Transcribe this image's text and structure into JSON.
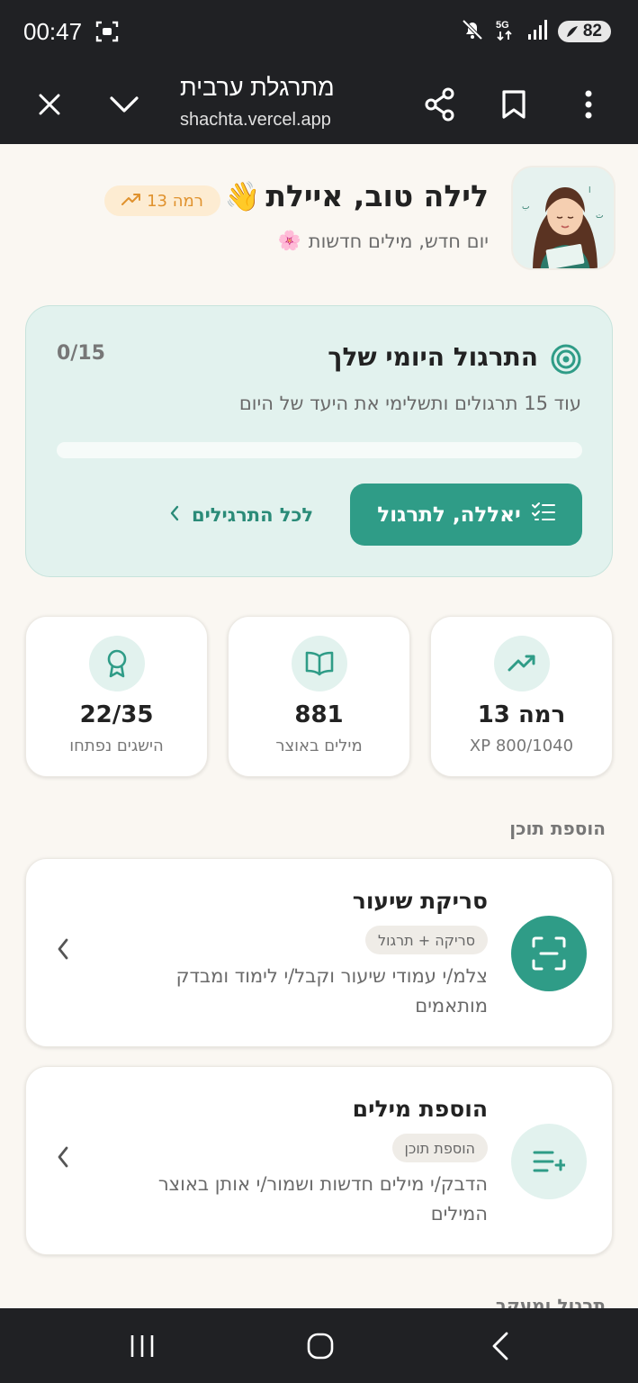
{
  "status_bar": {
    "time": "00:47",
    "battery": "82",
    "icons": [
      "screen-record-icon",
      "mute-icon",
      "5g-icon",
      "signal-icon",
      "battery-icon"
    ]
  },
  "browser": {
    "title": "מתרגלת ערבית",
    "url": "shachta.vercel.app"
  },
  "header": {
    "greeting": "לילה טוב, איילת",
    "greeting_emoji": "👋",
    "level_badge": "רמה 13",
    "subtitle": "יום חדש, מילים חדשות",
    "subtitle_emoji": "🌸"
  },
  "daily": {
    "title": "התרגול היומי שלך",
    "count": "0/15",
    "subtitle": "עוד 15 תרגולים ותשלימי את היעד של היום",
    "progress": 0,
    "start_button": "יאללה, לתרגול",
    "all_link": "לכל התרגילים"
  },
  "stats": [
    {
      "value": "רמה 13",
      "label": "XP 800/1040",
      "icon": "trending-up-icon"
    },
    {
      "value": "881",
      "label": "מילים באוצר",
      "icon": "book-icon"
    },
    {
      "value": "22/35",
      "label": "הישגים נפתחו",
      "icon": "award-icon"
    }
  ],
  "sections": {
    "add_content": "הוספת תוכן",
    "practice": "תרגול ומעקב"
  },
  "actions": [
    {
      "title": "סריקת שיעור",
      "badge": "סריקה + תרגול",
      "description": "צלמ/י עמודי שיעור וקבל/י לימוד ומבדק מותאמים",
      "icon": "scan-icon"
    },
    {
      "title": "הוספת מילים",
      "badge": "הוספת תוכן",
      "description": "הדבק/י מילים חדשות ושמור/י אותן באוצר המילים",
      "icon": "list-plus-icon"
    }
  ],
  "colors": {
    "accent": "#2f9c87",
    "accent_light": "#e2f2ee",
    "level_bg": "#fdecd2",
    "level_text": "#e0922e",
    "background": "#faf7f2",
    "system_bar": "#202124"
  }
}
